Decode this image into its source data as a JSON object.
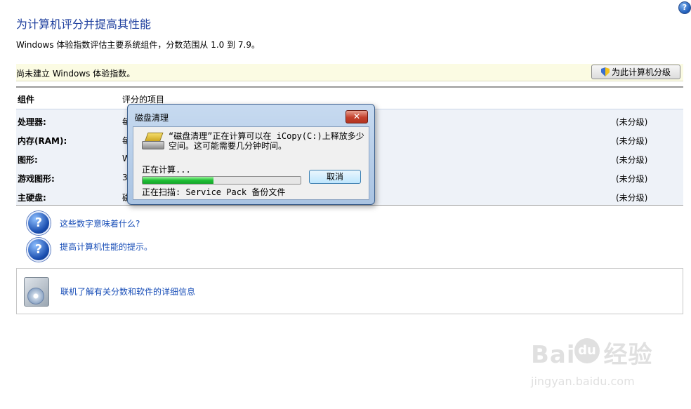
{
  "help_icon": "help-icon",
  "header": {
    "title": "为计算机评分并提高其性能",
    "description": "Windows 体验指数评估主要系统组件，分数范围从 1.0 到 7.9。"
  },
  "status": {
    "text": "尚未建立 Windows 体验指数。",
    "rate_button": "为此计算机分级"
  },
  "table": {
    "col_component": "组件",
    "col_rated": "评分的项目",
    "rows": [
      {
        "name": "处理器:",
        "desc": "每",
        "score": "(未分级)"
      },
      {
        "name": "内存(RAM):",
        "desc": "每",
        "score": "(未分级)"
      },
      {
        "name": "图形:",
        "desc": "W",
        "score": "(未分级)"
      },
      {
        "name": "游戏图形:",
        "desc": "3",
        "score": "(未分级)"
      },
      {
        "name": "主硬盘:",
        "desc": "磁",
        "score": "(未分级)"
      }
    ]
  },
  "links": {
    "numbers_meaning": "这些数字意味着什么?",
    "tips": "提高计算机性能的提示。",
    "online": "联机了解有关分数和软件的详细信息"
  },
  "dialog": {
    "title": "磁盘清理",
    "close": "✕",
    "message": "“磁盘清理”正在计算可以在 iCopy(C:)上释放多少空间。这可能需要几分钟时间。",
    "calculating": "正在计算...",
    "progress": 0.45,
    "cancel": "取消",
    "scanning": "正在扫描: Service Pack 备份文件"
  },
  "watermark": {
    "logo_left": "Bai",
    "logo_paw": "du",
    "logo_right": "经验",
    "url": "jingyan.baidu.com"
  }
}
